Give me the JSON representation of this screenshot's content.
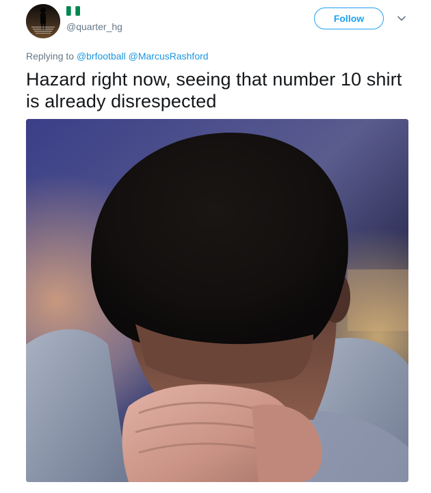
{
  "user": {
    "handle": "@quarter_hg",
    "flag_icon": "nigeria-flag-icon",
    "flag_colors": [
      "#008751",
      "#ffffff",
      "#008751"
    ]
  },
  "actions": {
    "follow_label": "Follow",
    "more_icon": "chevron-down-icon"
  },
  "reply_context": {
    "prefix": "Replying to",
    "mentions": [
      "@brfootball",
      "@MarcusRashford"
    ]
  },
  "tweet": {
    "text": "Hazard right now, seeing that number 10 shirt is already disrespected"
  },
  "media": {
    "description_icon": "crying-man-photo"
  },
  "colors": {
    "accent": "#1da1f2",
    "link": "#1b95e0",
    "muted": "#657786",
    "text": "#14171a"
  }
}
